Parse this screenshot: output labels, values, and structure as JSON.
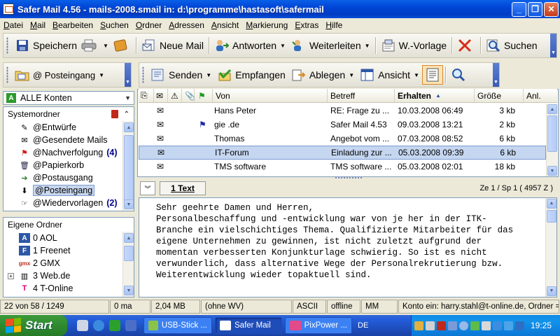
{
  "window": {
    "title": "Safer Mail 4.56 - mails-2008.smail in: d:\\programme\\hastasoft\\safermail",
    "minimize": "_",
    "maximize": "❐",
    "close": "✕"
  },
  "menu": [
    "Datei",
    "Mail",
    "Bearbeiten",
    "Suchen",
    "Ordner",
    "Adressen",
    "Ansicht",
    "Markierung",
    "Extras",
    "Hilfe"
  ],
  "toolbar_main": {
    "save": "Speichern",
    "new_mail": "Neue Mail",
    "reply": "Antworten",
    "forward": "Weiterleiten",
    "template": "W.-Vorlage",
    "search": "Suchen"
  },
  "toolbar_secondary": {
    "folder_select": "@ Posteingang",
    "send": "Senden",
    "receive": "Empfangen",
    "file": "Ablegen",
    "view": "Ansicht"
  },
  "accounts": {
    "selector": "ALLE Konten",
    "system_folders_title": "Systemordner",
    "system_folders": [
      {
        "label": "@Entwürfe",
        "count": ""
      },
      {
        "label": "@Gesendete Mails",
        "count": ""
      },
      {
        "label": "@Nachverfolgung",
        "count": "(4)"
      },
      {
        "label": "@Papierkorb",
        "count": ""
      },
      {
        "label": "@Postausgang",
        "count": ""
      },
      {
        "label": "@Posteingang",
        "count": ""
      },
      {
        "label": "@Wiedervorlagen",
        "count": "(2)"
      }
    ],
    "own_folders_title": "Eigene Ordner",
    "own_folders": [
      {
        "badge": "A",
        "label": "0 AOL"
      },
      {
        "badge": "F",
        "label": "1 Freenet"
      },
      {
        "badge": "gmx",
        "label": "2 GMX"
      },
      {
        "badge": "",
        "label": "3 Web.de"
      },
      {
        "badge": "",
        "label": "4 T-Online"
      }
    ]
  },
  "message_list": {
    "columns": {
      "from": "Von",
      "subject": "Betreff",
      "received": "Erhalten",
      "size": "Größe",
      "attachments": "Anl."
    },
    "rows": [
      {
        "from": "Hans Peter",
        "subject": "RE: Frage zu ...",
        "received": "10.03.2008 06:49",
        "size": "3 kb",
        "flag": false
      },
      {
        "from": "gie         .de",
        "subject": "Safer Mail 4.53",
        "received": "09.03.2008 13:21",
        "size": "2 kb",
        "flag": true
      },
      {
        "from": "Thomas",
        "subject": "Angebot vom ...",
        "received": "07.03.2008 08:52",
        "size": "6 kb",
        "flag": false
      },
      {
        "from": "IT-Forum",
        "subject": "Einladung zur ...",
        "received": "05.03.2008 09:39",
        "size": "6 kb",
        "flag": false
      },
      {
        "from": "TMS software",
        "subject": "TMS software ...",
        "received": "05.03.2008 02:01",
        "size": "18 kb",
        "flag": false
      }
    ]
  },
  "preview": {
    "tab": "1 Text",
    "position": "Ze 1 / Sp 1 ( 4957 Z )",
    "lines": [
      "Sehr geehrte Damen und Herren,",
      "",
      "Personalbeschaffung und -entwicklung war von je her in der ITK-",
      "Branche ein vielschichtiges Thema. Qualifizierte Mitarbeiter für das",
      "eigene Unternehmen zu gewinnen, ist nicht zuletzt aufgrund der",
      "momentan verbesserten Konjunkturlage schwierig. So ist es nicht",
      "verwunderlich, dass alternative Wege der Personalrekrutierung bzw.",
      "Weiterentwicklung wieder topaktuell sind."
    ]
  },
  "status": {
    "count": "22 von 58 / 1249",
    "time": "0 ma",
    "size": "2,04 MB",
    "wv": "(ohne WV)",
    "encoding": "ASCII",
    "online": "offline",
    "mm": "MM",
    "account": "Konto ein: harry.stahl@t-online.de, Ordner ="
  },
  "taskbar": {
    "start": "Start",
    "tasks": [
      "USB-Stick ...",
      "Safer Mail",
      "PixPower ..."
    ],
    "language": "DE",
    "clock": "19:25"
  }
}
